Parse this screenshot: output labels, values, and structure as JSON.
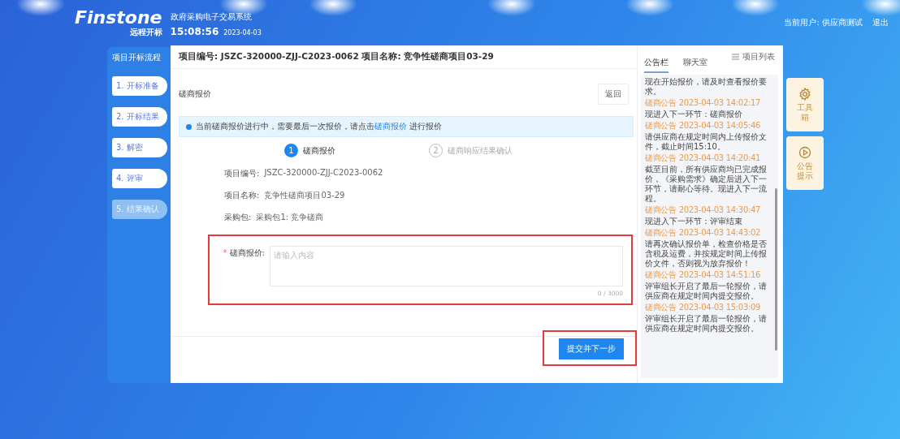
{
  "header": {
    "logo": "Finstone",
    "logo_subtitle": "远程开标",
    "system_name": "政府采购电子交易系统",
    "clock": "15:08:56",
    "date": "2023-04-03",
    "user": "当前用户: 供应商测试",
    "logout": "退出"
  },
  "sidebar": {
    "title": "项目开标流程",
    "items": [
      {
        "label": "1. 开标准备",
        "selected": false
      },
      {
        "label": "2. 开标结果",
        "selected": false
      },
      {
        "label": "3. 解密",
        "selected": false
      },
      {
        "label": "4. 评审",
        "selected": false
      },
      {
        "label": "5. 结果确认",
        "selected": true
      }
    ]
  },
  "project": {
    "title": "项目编号: JSZC-320000-ZJJ-C2023-0062 项目名称: 竞争性磋商项目03-29",
    "list_link": "项目列表"
  },
  "section": {
    "title": "磋商报价",
    "back_button": "返回"
  },
  "alert": {
    "text_before": "当前磋商报价进行中，需要最后一次报价，请点击",
    "link": "磋商报价",
    "text_after": "进行报价"
  },
  "steps": [
    {
      "number": "1",
      "label": "磋商报价",
      "selected": true
    },
    {
      "number": "2",
      "label": "磋商响应结果确认",
      "selected": false
    }
  ],
  "fields": [
    {
      "label": "项目编号:",
      "value": "JSZC-320000-ZJJ-C2023-0062"
    },
    {
      "label": "项目名称:",
      "value": "竞争性磋商项目03-29"
    },
    {
      "label": "采购包:",
      "value": "采购包1: 竞争磋商"
    }
  ],
  "quote": {
    "required_mark": "*",
    "label": "磋商报价:",
    "placeholder": "请输入内容",
    "counter": "0 / 3000",
    "highlighted": true
  },
  "submit_button": {
    "label": "提交并下一步",
    "highlighted": true
  },
  "notice_panel": {
    "tabs": [
      {
        "label": "公告栏",
        "selected": true
      },
      {
        "label": "聊天室",
        "selected": false
      }
    ],
    "intro": "现在开始报价，请及时查看报价要求。",
    "messages": [
      {
        "title": "磋商公告 2023-04-03 14:02:17",
        "text": "现进入下一环节：磋商报价"
      },
      {
        "title": "磋商公告 2023-04-03 14:05:46",
        "text": "请供应商在规定时间内上传报价文件，截止时间15:10。"
      },
      {
        "title": "磋商公告 2023-04-03 14:20:41",
        "text": "截至目前，所有供应商均已完成报价，《采购需求》确定后进入下一环节，请耐心等待。现进入下一流程。"
      },
      {
        "title": "磋商公告 2023-04-03 14:30:47",
        "text": "现进入下一环节：评审结束"
      },
      {
        "title": "磋商公告 2023-04-03 14:43:02",
        "text": "请再次确认报价单，检查价格是否含税及运费，并按规定时间上传报价文件，否则视为放弃报价！"
      },
      {
        "title": "磋商公告 2023-04-03 14:51:16",
        "text": "评审组长开启了最后一轮报价，请供应商在规定时间内提交报价。"
      },
      {
        "title": "磋商公告 2023-04-03 15:03:09",
        "text": "评审组长开启了最后一轮报价，请供应商在规定时间内提交报价。"
      }
    ]
  },
  "tools": [
    {
      "label": "工具箱",
      "kind": "gear"
    },
    {
      "label": "公告提示",
      "kind": "play"
    }
  ]
}
